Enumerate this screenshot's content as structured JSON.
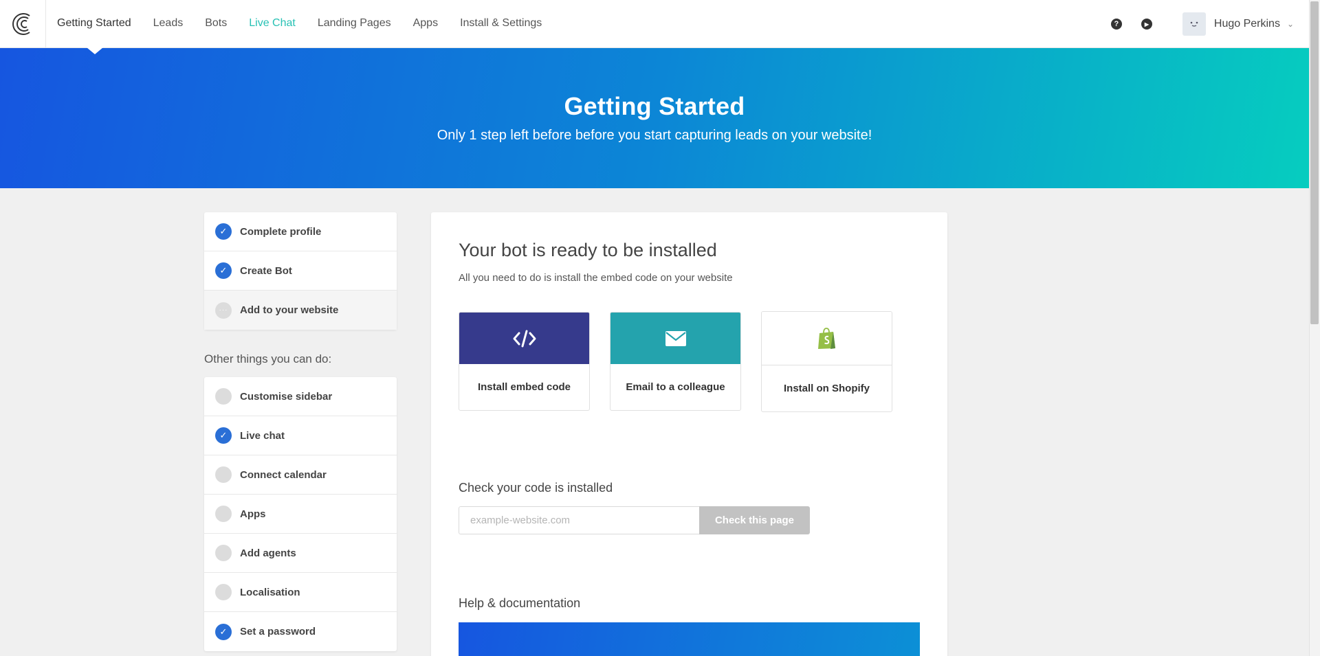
{
  "nav": {
    "items": [
      {
        "label": "Getting Started"
      },
      {
        "label": "Leads"
      },
      {
        "label": "Bots"
      },
      {
        "label": "Live Chat"
      },
      {
        "label": "Landing Pages"
      },
      {
        "label": "Apps"
      },
      {
        "label": "Install & Settings"
      }
    ],
    "user_name": "Hugo Perkins",
    "help_icon": "?",
    "play_icon": "▶",
    "chevron": "⌄"
  },
  "hero": {
    "title": "Getting Started",
    "subtitle": "Only 1 step left before before you start capturing leads on your website!"
  },
  "steps": [
    {
      "label": "Complete profile",
      "done": true
    },
    {
      "label": "Create Bot",
      "done": true
    },
    {
      "label": "Add to your website",
      "done": false
    }
  ],
  "other": {
    "title": "Other things you can do:",
    "items": [
      {
        "label": "Customise sidebar",
        "done": false
      },
      {
        "label": "Live chat",
        "done": true
      },
      {
        "label": "Connect calendar",
        "done": false
      },
      {
        "label": "Apps",
        "done": false
      },
      {
        "label": "Add agents",
        "done": false
      },
      {
        "label": "Localisation",
        "done": false
      },
      {
        "label": "Set a password",
        "done": true
      }
    ]
  },
  "main": {
    "title": "Your bot is ready to be installed",
    "subtitle": "All you need to do is install the embed code on your website",
    "options": [
      {
        "label": "Install embed code",
        "icon": "code-icon"
      },
      {
        "label": "Email to a colleague",
        "icon": "envelope-icon"
      },
      {
        "label": "Install on Shopify",
        "icon": "shopify-icon"
      }
    ],
    "check_title": "Check your code is installed",
    "url_placeholder": "example-website.com",
    "check_button": "Check this page",
    "help_title": "Help & documentation"
  },
  "colors": {
    "accent": "#2a6fd6",
    "live_chat": "#27c1b4",
    "embed_tile": "#363a8c",
    "email_tile": "#24a3ad"
  }
}
